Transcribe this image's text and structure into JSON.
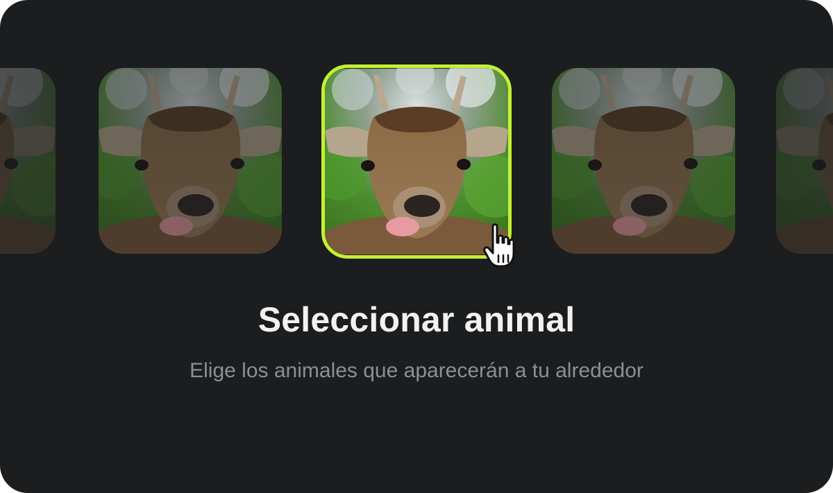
{
  "header": {
    "title": "Seleccionar animal",
    "subtitle": "Elige los animales que aparecerán a tu alrededor"
  },
  "carousel": {
    "items": [
      {
        "name": "deer",
        "state": "partial"
      },
      {
        "name": "deer",
        "state": "unselected"
      },
      {
        "name": "deer",
        "state": "selected"
      },
      {
        "name": "deer",
        "state": "unselected"
      },
      {
        "name": "deer",
        "state": "partial"
      }
    ],
    "selected_index": 2
  },
  "colors": {
    "background": "#1c1d1f",
    "accent": "#c5f033",
    "title": "#f2f2f2",
    "subtitle": "#8e8f92"
  },
  "icons": {
    "cursor": "hand-pointer-icon"
  }
}
